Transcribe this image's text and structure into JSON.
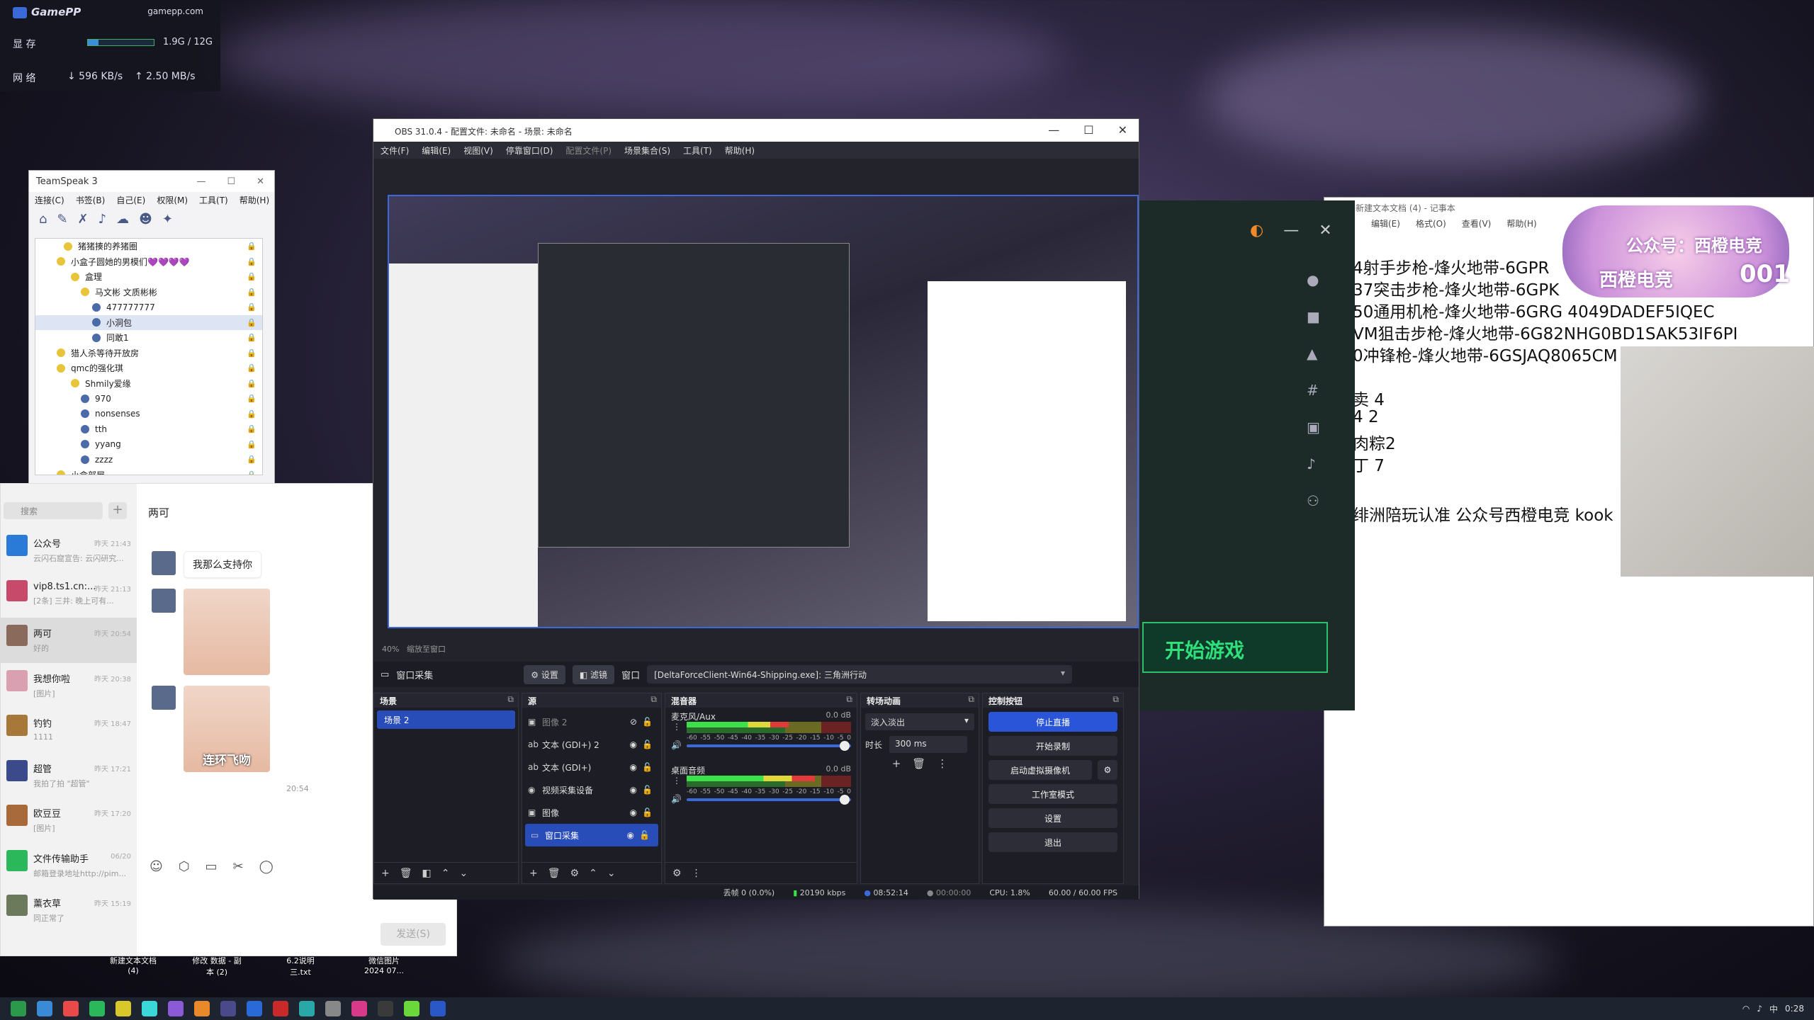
{
  "gamepp": {
    "logo": "GamePP",
    "site": "gamepp.com",
    "mem_label": "显 存",
    "mem_value": "1.9G / 12G",
    "mem_fill": 0.16,
    "net_label": "网 络",
    "down": "↓ 596 KB/s",
    "up": "↑ 2.50 MB/s"
  },
  "teamspeak": {
    "title": "TeamSpeak 3",
    "menu": [
      "连接(C)",
      "书签(B)",
      "自己(E)",
      "权限(M)",
      "工具(T)",
      "帮助(H)"
    ],
    "tree": [
      {
        "label": "猪猪揍的养猪圈",
        "indent": 40,
        "type": "channel"
      },
      {
        "label": "小盒子圆她的男模们💜💜💜💜",
        "indent": 30,
        "type": "channel"
      },
      {
        "label": "盒理",
        "indent": 50,
        "type": "channel"
      },
      {
        "label": "马文彬 文质彬彬",
        "indent": 64,
        "type": "channel"
      },
      {
        "label": "477777777",
        "indent": 80,
        "type": "user"
      },
      {
        "label": "小洞包",
        "indent": 80,
        "type": "user"
      },
      {
        "label": "同敢1",
        "indent": 80,
        "type": "user"
      },
      {
        "label": "猎人杀等待开放房",
        "indent": 30,
        "type": "channel"
      },
      {
        "label": "qmc的强化琪",
        "indent": 30,
        "type": "channel"
      },
      {
        "label": "Shmily爱缘",
        "indent": 50,
        "type": "channel"
      },
      {
        "label": "970",
        "indent": 64,
        "type": "user"
      },
      {
        "label": "nonsenses",
        "indent": 64,
        "type": "user"
      },
      {
        "label": "tth",
        "indent": 64,
        "type": "user"
      },
      {
        "label": "yyang",
        "indent": 64,
        "type": "user"
      },
      {
        "label": "zzzz",
        "indent": 64,
        "type": "user"
      },
      {
        "label": "小盒部屋",
        "indent": 30,
        "type": "channel"
      }
    ]
  },
  "qq": {
    "search_placeholder": "搜索",
    "chat_title": "两可",
    "bubble": "我那么支持你",
    "caption": "连环飞吻",
    "time": "20:54",
    "send": "发送(S)",
    "convs": [
      {
        "name": "公众号",
        "msg": "云闪石窟宣告: 云闪研究...",
        "time": "昨天 21:43",
        "color": "#2a7ad8"
      },
      {
        "name": "vip8.ts1.cn:...",
        "msg": "[2条] 三井: 晚上可有...",
        "time": "昨天 21:13",
        "color": "#c84a6a"
      },
      {
        "name": "两可",
        "msg": "好的",
        "time": "昨天 20:54",
        "color": "#8a6a5a"
      },
      {
        "name": "我想你啦",
        "msg": "[图片]",
        "time": "昨天 20:38",
        "color": "#d8a0b0"
      },
      {
        "name": "钓钓",
        "msg": "1111",
        "time": "昨天 18:47",
        "color": "#a8783a"
      },
      {
        "name": "超管",
        "msg": "我拍了拍 \"超管\"",
        "time": "昨天 17:21",
        "color": "#3a4a8a"
      },
      {
        "name": "欧豆豆",
        "msg": "[图片]",
        "time": "昨天 17:20",
        "color": "#a86a3a"
      },
      {
        "name": "文件传输助手",
        "msg": "邮箱登录地址http://pim...",
        "time": "06/20",
        "color": "#2ab85a"
      },
      {
        "name": "薰衣草",
        "msg": "同正常了",
        "time": "昨天 15:19",
        "color": "#6a7a5a"
      }
    ]
  },
  "notepad": {
    "title": "新建文本文档 (4) - 记事本",
    "menu": [
      "编辑(E)",
      "格式(O)",
      "查看(V)",
      "帮助(H)"
    ],
    "lines": [
      "4射手步枪-烽火地带-6GPR",
      "37突击步枪-烽火地带-6GPK",
      "50通用机枪-烽火地带-6GRG 4049DADEF5IQEC",
      "VM狙击步枪-烽火地带-6G82NHG0BD1SAK53IF6PI",
      "0冲锋枪-烽火地带-6GSJAQ8065CM",
      "",
      "卖 4",
      "4 2",
      "肉粽2",
      "丁 7",
      "",
      "绯洲陪玩认准  公众号西橙电竞 kook"
    ]
  },
  "fan": {
    "gongzhong": "公众号：西橙电竞",
    "name": "西橙电竞",
    "num": "001"
  },
  "launcher": {
    "start": "开始游戏"
  },
  "obs": {
    "title": "OBS 31.0.4 - 配置文件: 未命名 - 场景: 未命名",
    "menu": [
      "文件(F)",
      "编辑(E)",
      "视图(V)",
      "停靠窗口(D)",
      "配置文件(P)",
      "场景集合(S)",
      "工具(T)",
      "帮助(H)"
    ],
    "zoom": "40%",
    "preview_mode": "缩放至窗口",
    "current_source": "窗口采集",
    "settings_btn": "设置",
    "filters_btn": "滤镜",
    "window_label": "窗口",
    "window_value": "[DeltaForceClient-Win64-Shipping.exe]: 三角洲行动",
    "docks": {
      "scenes": "场景",
      "sources": "源",
      "mixer": "混音器",
      "transitions": "转场动画",
      "controls": "控制按钮"
    },
    "scenes": [
      "场景 2"
    ],
    "sources": [
      {
        "name": "图像 2",
        "icon": "image-icon",
        "hidden": true
      },
      {
        "name": "文本 (GDI+) 2",
        "icon": "text-icon",
        "hidden": false
      },
      {
        "name": "文本 (GDI+)",
        "icon": "text-icon",
        "hidden": false
      },
      {
        "name": "视频采集设备",
        "icon": "camera-icon",
        "hidden": false
      },
      {
        "name": "图像",
        "icon": "image-icon",
        "hidden": false
      },
      {
        "name": "窗口采集",
        "icon": "window-icon",
        "hidden": false,
        "selected": true
      }
    ],
    "mixer": [
      {
        "name": "麦克风/Aux",
        "db": "0.0 dB",
        "level": 0.62
      },
      {
        "name": "桌面音频",
        "db": "0.0 dB",
        "level": 0.78
      }
    ],
    "mixer_scale": [
      "-60",
      "-55",
      "-50",
      "-45",
      "-40",
      "-35",
      "-30",
      "-25",
      "-20",
      "-15",
      "-10",
      "-5",
      "0"
    ],
    "transition": "淡入淡出",
    "duration_label": "时长",
    "duration": "300 ms",
    "controls": [
      "停止直播",
      "开始录制",
      "启动虚拟摄像机",
      "工作室模式",
      "设置",
      "退出"
    ],
    "status": {
      "dropped": "丢帧 0 (0.0%)",
      "bitrate": "20190 kbps",
      "stream_time": "08:52:14",
      "rec_time": "00:00:00",
      "cpu": "CPU: 1.8%",
      "fps": "60.00 / 60.00 FPS"
    }
  },
  "desktop_icons": [
    "新建文本文档 (4)",
    "修改 数据 - 副本 (2)",
    "6.2说明 三.txt",
    "微信图片 2024 07..."
  ],
  "tray": {
    "time": "0:28",
    "lang": "中"
  }
}
